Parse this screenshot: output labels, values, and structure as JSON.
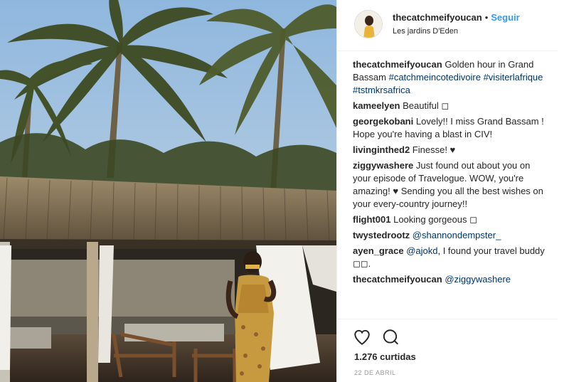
{
  "header": {
    "username": "thecatchmeifyoucan",
    "separator": "•",
    "follow_label": "Seguir",
    "location": "Les jardins D'Eden"
  },
  "comments": [
    {
      "user": "thecatchmeifyoucan",
      "text": "Golden hour in Grand Bassam",
      "tags": [
        "#catchmeincotedivoire",
        "#visiterlafrique",
        "#tstmkrsafrica"
      ]
    },
    {
      "user": "kameelyen",
      "text": "Beautiful ◻"
    },
    {
      "user": "georgekobani",
      "text": "Lovely!! I miss Grand Bassam ! Hope you're having a blast in CIV!"
    },
    {
      "user": "livinginthed2",
      "text": "Finesse! ♥"
    },
    {
      "user": "ziggywashere",
      "text": "Just found out about you on your episode of Travelogue. WOW, you're amazing! ♥ Sending you all the best wishes on your every-country journey!!"
    },
    {
      "user": "flight001",
      "text": "Looking gorgeous ◻"
    },
    {
      "user": "twystedrootz",
      "mention": "@shannondempster_"
    },
    {
      "user": "ayen_grace",
      "mention": "@ajokd",
      "text": ", I found your travel buddy ◻◻."
    },
    {
      "user": "thecatchmeifyoucan",
      "mention": "@ziggywashere"
    }
  ],
  "actions": {
    "like_icon": "heart-icon",
    "comment_icon": "comment-icon",
    "likes_label": "1.276 curtidas",
    "date_label": "22 DE ABRIL"
  },
  "colors": {
    "link": "#003569",
    "follow": "#3897f0",
    "text": "#262626",
    "muted": "#999999"
  }
}
